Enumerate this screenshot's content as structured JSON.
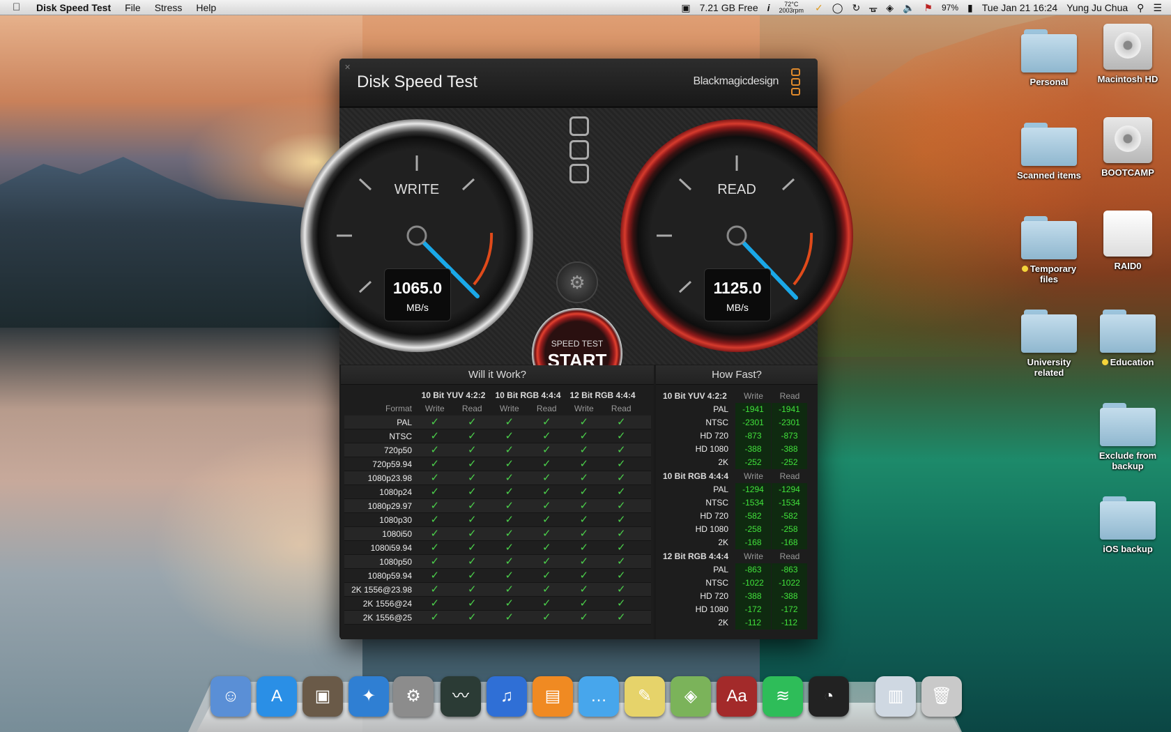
{
  "menubar": {
    "app_name": "Disk Speed Test",
    "items": [
      "File",
      "Stress",
      "Help"
    ],
    "disk_free": "7.21 GB Free",
    "temp": "72°C",
    "rpm": "2003rpm",
    "battery": "97%",
    "datetime": "Tue Jan 21  16:24",
    "user": "Yung Ju Chua"
  },
  "desktop_icons": [
    {
      "label": "Personal",
      "type": "folder"
    },
    {
      "label": "Macintosh HD",
      "type": "drive"
    },
    {
      "label": "Scanned items",
      "type": "folder"
    },
    {
      "label": "BOOTCAMP",
      "type": "drive"
    },
    {
      "label": "Temporary files",
      "type": "folder",
      "tag": "yellow"
    },
    {
      "label": "RAID0",
      "type": "drive-white"
    },
    {
      "label": "University related",
      "type": "folder"
    },
    {
      "label": "Education",
      "type": "folder",
      "tag": "yellow"
    },
    {
      "label": "Exclude from backup",
      "type": "folder"
    },
    {
      "label": "iOS backup",
      "type": "folder"
    }
  ],
  "window": {
    "title": "Disk Speed Test",
    "brand": "Blackmagicdesign",
    "write": {
      "label": "WRITE",
      "value": "1065.0",
      "unit": "MB/s"
    },
    "read": {
      "label": "READ",
      "value": "1125.0",
      "unit": "MB/s"
    },
    "start": {
      "line1": "SPEED TEST",
      "line2": "START"
    }
  },
  "will_it_work": {
    "title": "Will it Work?",
    "groups": [
      "10 Bit YUV 4:2:2",
      "10 Bit RGB 4:4:4",
      "12 Bit RGB 4:4:4"
    ],
    "format_header": "Format",
    "sub_headers": [
      "Write",
      "Read",
      "Write",
      "Read",
      "Write",
      "Read"
    ],
    "formats": [
      "PAL",
      "NTSC",
      "720p50",
      "720p59.94",
      "1080p23.98",
      "1080p24",
      "1080p29.97",
      "1080p30",
      "1080i50",
      "1080i59.94",
      "1080p50",
      "1080p59.94",
      "2K 1556@23.98",
      "2K 1556@24",
      "2K 1556@25"
    ],
    "check": "✓"
  },
  "how_fast": {
    "title": "How Fast?",
    "col_write": "Write",
    "col_read": "Read",
    "groups": [
      {
        "name": "10 Bit YUV 4:2:2",
        "rows": [
          {
            "f": "PAL",
            "w": "-1941",
            "r": "-1941"
          },
          {
            "f": "NTSC",
            "w": "-2301",
            "r": "-2301"
          },
          {
            "f": "HD 720",
            "w": "-873",
            "r": "-873"
          },
          {
            "f": "HD 1080",
            "w": "-388",
            "r": "-388"
          },
          {
            "f": "2K",
            "w": "-252",
            "r": "-252"
          }
        ]
      },
      {
        "name": "10 Bit RGB 4:4:4",
        "rows": [
          {
            "f": "PAL",
            "w": "-1294",
            "r": "-1294"
          },
          {
            "f": "NTSC",
            "w": "-1534",
            "r": "-1534"
          },
          {
            "f": "HD 720",
            "w": "-582",
            "r": "-582"
          },
          {
            "f": "HD 1080",
            "w": "-258",
            "r": "-258"
          },
          {
            "f": "2K",
            "w": "-168",
            "r": "-168"
          }
        ]
      },
      {
        "name": "12 Bit RGB 4:4:4",
        "rows": [
          {
            "f": "PAL",
            "w": "-863",
            "r": "-863"
          },
          {
            "f": "NTSC",
            "w": "-1022",
            "r": "-1022"
          },
          {
            "f": "HD 720",
            "w": "-388",
            "r": "-388"
          },
          {
            "f": "HD 1080",
            "w": "-172",
            "r": "-172"
          },
          {
            "f": "2K",
            "w": "-112",
            "r": "-112"
          }
        ]
      }
    ]
  },
  "dock": {
    "items": [
      {
        "name": "finder-icon",
        "color": "#5a8fd6"
      },
      {
        "name": "app-store-icon",
        "color": "#2a8fe6"
      },
      {
        "name": "image-capture-icon",
        "color": "#6a5a48"
      },
      {
        "name": "safari-icon",
        "color": "#2f7fd3"
      },
      {
        "name": "system-preferences-icon",
        "color": "#8c8c8c"
      },
      {
        "name": "activity-monitor-icon",
        "color": "#2b3b35"
      },
      {
        "name": "itunes-icon",
        "color": "#2f6fd6"
      },
      {
        "name": "ibooks-icon",
        "color": "#f08a22"
      },
      {
        "name": "messages-icon",
        "color": "#47a6ec"
      },
      {
        "name": "stickies-icon",
        "color": "#e6d36a"
      },
      {
        "name": "maps-icon",
        "color": "#7bb35a"
      },
      {
        "name": "dictionary-icon",
        "color": "#a32a2a"
      },
      {
        "name": "spotify-icon",
        "color": "#2ebd59"
      },
      {
        "name": "disk-speed-test-icon",
        "color": "#222222"
      },
      {
        "name": "downloads-stack-icon",
        "color": "#cfd8e2"
      },
      {
        "name": "trash-icon",
        "color": "#c9c9c9"
      }
    ]
  }
}
